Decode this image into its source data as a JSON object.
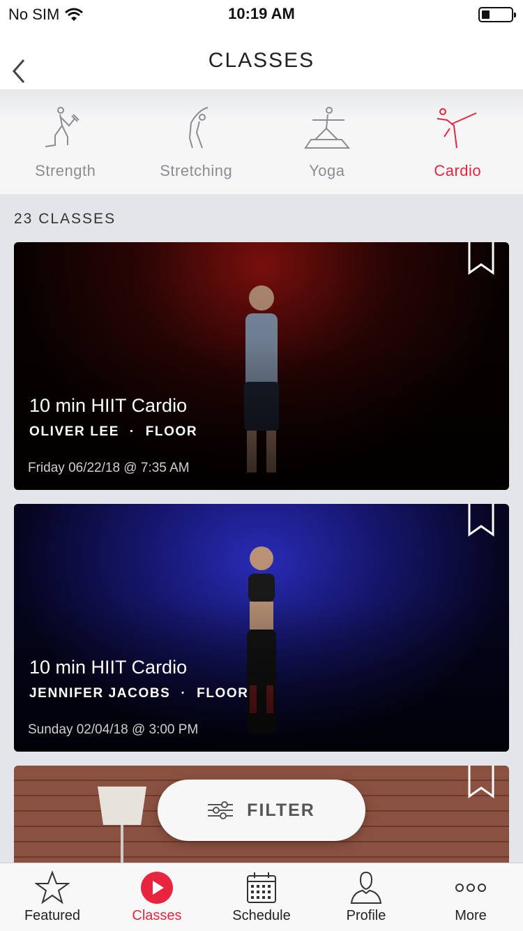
{
  "status_bar": {
    "carrier": "No SIM",
    "time": "10:19 AM"
  },
  "nav": {
    "title": "CLASSES"
  },
  "categories": [
    {
      "label": "Strength",
      "icon": "strength-icon",
      "active": false
    },
    {
      "label": "Stretching",
      "icon": "stretching-icon",
      "active": false
    },
    {
      "label": "Yoga",
      "icon": "yoga-icon",
      "active": false
    },
    {
      "label": "Cardio",
      "icon": "cardio-icon",
      "active": true
    }
  ],
  "class_count": "23 CLASSES",
  "classes": [
    {
      "title": "10 min HIIT Cardio",
      "instructor": "OLIVER LEE",
      "discipline": "FLOOR",
      "date": "Friday 06/22/18 @ 7:35 AM"
    },
    {
      "title": "10 min HIIT Cardio",
      "instructor": "JENNIFER JACOBS",
      "discipline": "FLOOR",
      "date": "Sunday 02/04/18 @ 3:00 PM"
    }
  ],
  "meta_separator": "·",
  "filter": {
    "label": "FILTER"
  },
  "tabs": [
    {
      "label": "Featured",
      "icon": "star-icon",
      "active": false
    },
    {
      "label": "Classes",
      "icon": "play-icon",
      "active": true
    },
    {
      "label": "Schedule",
      "icon": "calendar-icon",
      "active": false
    },
    {
      "label": "Profile",
      "icon": "person-icon",
      "active": false
    },
    {
      "label": "More",
      "icon": "more-icon",
      "active": false
    }
  ],
  "colors": {
    "accent": "#e8243e",
    "inactive": "#8a8d92"
  }
}
